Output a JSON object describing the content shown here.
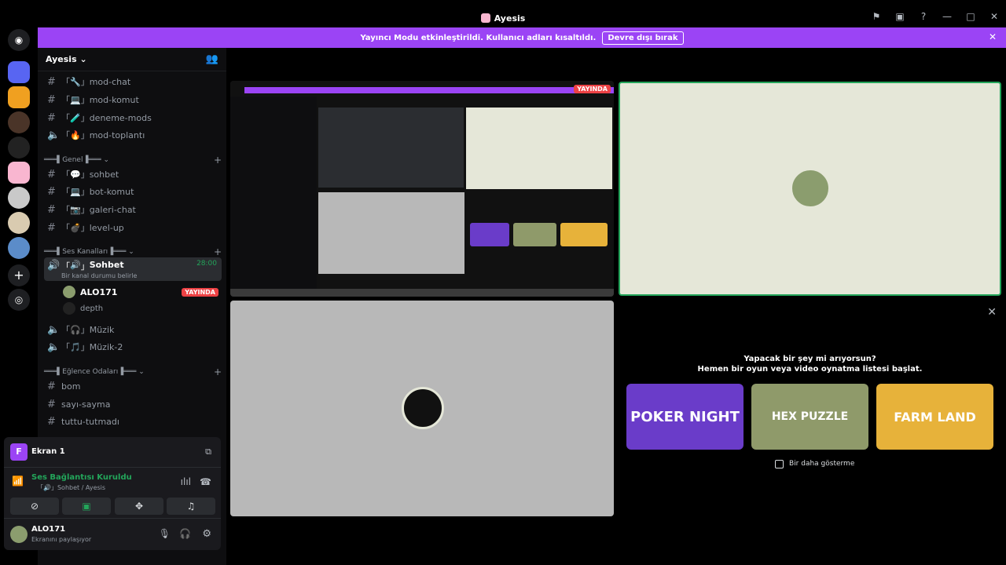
{
  "window": {
    "title": "Ayesis"
  },
  "banner": {
    "text": "Yayıncı Modu etkinleştirildi. Kullanıcı adları kısaltıldı.",
    "button": "Devre dışı bırak"
  },
  "guild": {
    "name": "Ayesis"
  },
  "channels": {
    "mod": [
      {
        "icon": "🔧",
        "label": "mod-chat"
      },
      {
        "icon": "💻",
        "label": "mod-komut"
      },
      {
        "icon": "🧪",
        "label": "deneme-mods"
      },
      {
        "icon": "🔥",
        "label": "mod-toplantı"
      }
    ],
    "genel_label": "Genel",
    "genel": [
      {
        "icon": "💬",
        "label": "sohbet"
      },
      {
        "icon": "💻",
        "label": "bot-komut"
      },
      {
        "icon": "📷",
        "label": "galeri-chat"
      },
      {
        "icon": "💣",
        "label": "level-up"
      }
    ],
    "ses_label": "Ses Kanalları",
    "sohbet": {
      "label": "Sohbet",
      "icon": "🔊",
      "timer": "28:00",
      "status": "Bir kanal durumu belirle"
    },
    "voice_users": [
      {
        "name": "ALO171",
        "badge": "YAYINDA"
      },
      {
        "name": "depth",
        "badge": ""
      }
    ],
    "ses_more": [
      {
        "icon": "🎧",
        "label": "Müzik"
      },
      {
        "icon": "🎵",
        "label": "Müzik-2"
      }
    ],
    "eglence_label": "Eğlence Odaları",
    "eglence": [
      {
        "label": "bom"
      },
      {
        "label": "sayı-sayma"
      },
      {
        "label": "tuttu-tutmadı"
      }
    ]
  },
  "voice_panel": {
    "screen_title": "Ekran 1",
    "connected": "Ses Bağlantısı Kuruldu",
    "location": "Sohbet / Ayesis",
    "user_name": "ALO171",
    "user_status": "Ekranını paylaşıyor"
  },
  "activity": {
    "heading1": "Yapacak bir şey mi arıyorsun?",
    "heading2": "Hemen bir oyun veya video oynatma listesi başlat.",
    "games": [
      "POKER NIGHT",
      "HEX PUZZLE",
      "FARM LAND"
    ],
    "checkbox": "Bir daha gösterme"
  },
  "colors": {
    "accent": "#9b44f5",
    "green": "#23a55a",
    "red": "#ed4245"
  }
}
